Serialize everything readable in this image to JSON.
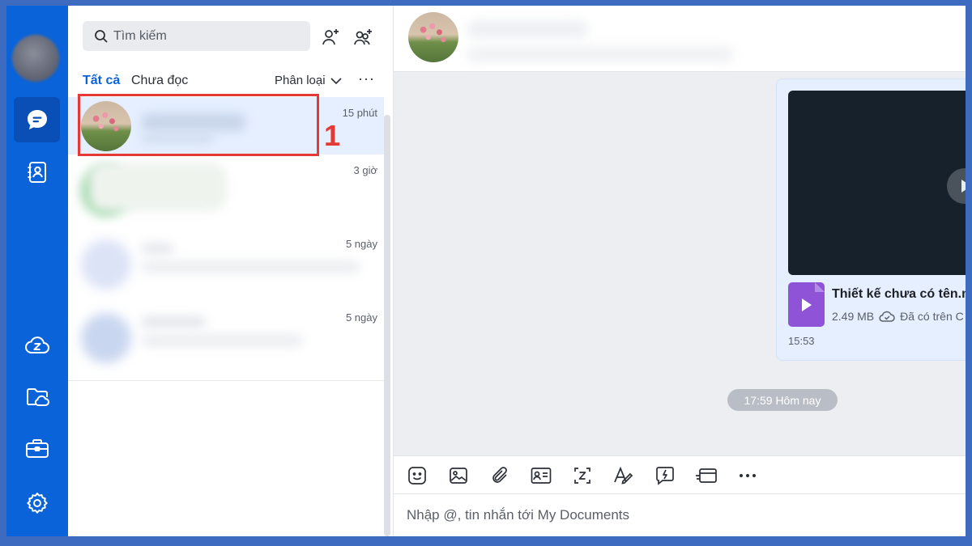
{
  "search": {
    "placeholder": "Tìm kiếm"
  },
  "filters": {
    "all": "Tất cả",
    "unread": "Chưa đọc",
    "classify": "Phân loại",
    "more": "···"
  },
  "conversations": [
    {
      "time": "15 phút"
    },
    {
      "time": "3 giờ"
    },
    {
      "time": "5 ngày"
    },
    {
      "time": "5 ngày"
    }
  ],
  "annotation": {
    "number": "1"
  },
  "message": {
    "file_name": "Thiết kế chưa có tên.m",
    "file_size": "2.49 MB",
    "cloud_status": "Đã có trên C",
    "time": "15:53"
  },
  "date_separator": "17:59 Hôm nay",
  "composer": {
    "placeholder": "Nhập @, tin nhắn tới My Documents"
  },
  "colors": {
    "rail": "#0a63d8",
    "accent": "#0a63d8",
    "annotation": "#e53935"
  },
  "icons": {
    "rail": [
      "chat-icon",
      "contacts-icon",
      "zcloud-icon",
      "folder-cloud-icon",
      "briefcase-icon",
      "settings-icon"
    ],
    "toolbar": [
      "sticker-icon",
      "image-icon",
      "attach-icon",
      "contact-card-icon",
      "screenshot-icon",
      "format-text-icon",
      "quick-message-icon",
      "card-icon",
      "more-icon"
    ]
  }
}
